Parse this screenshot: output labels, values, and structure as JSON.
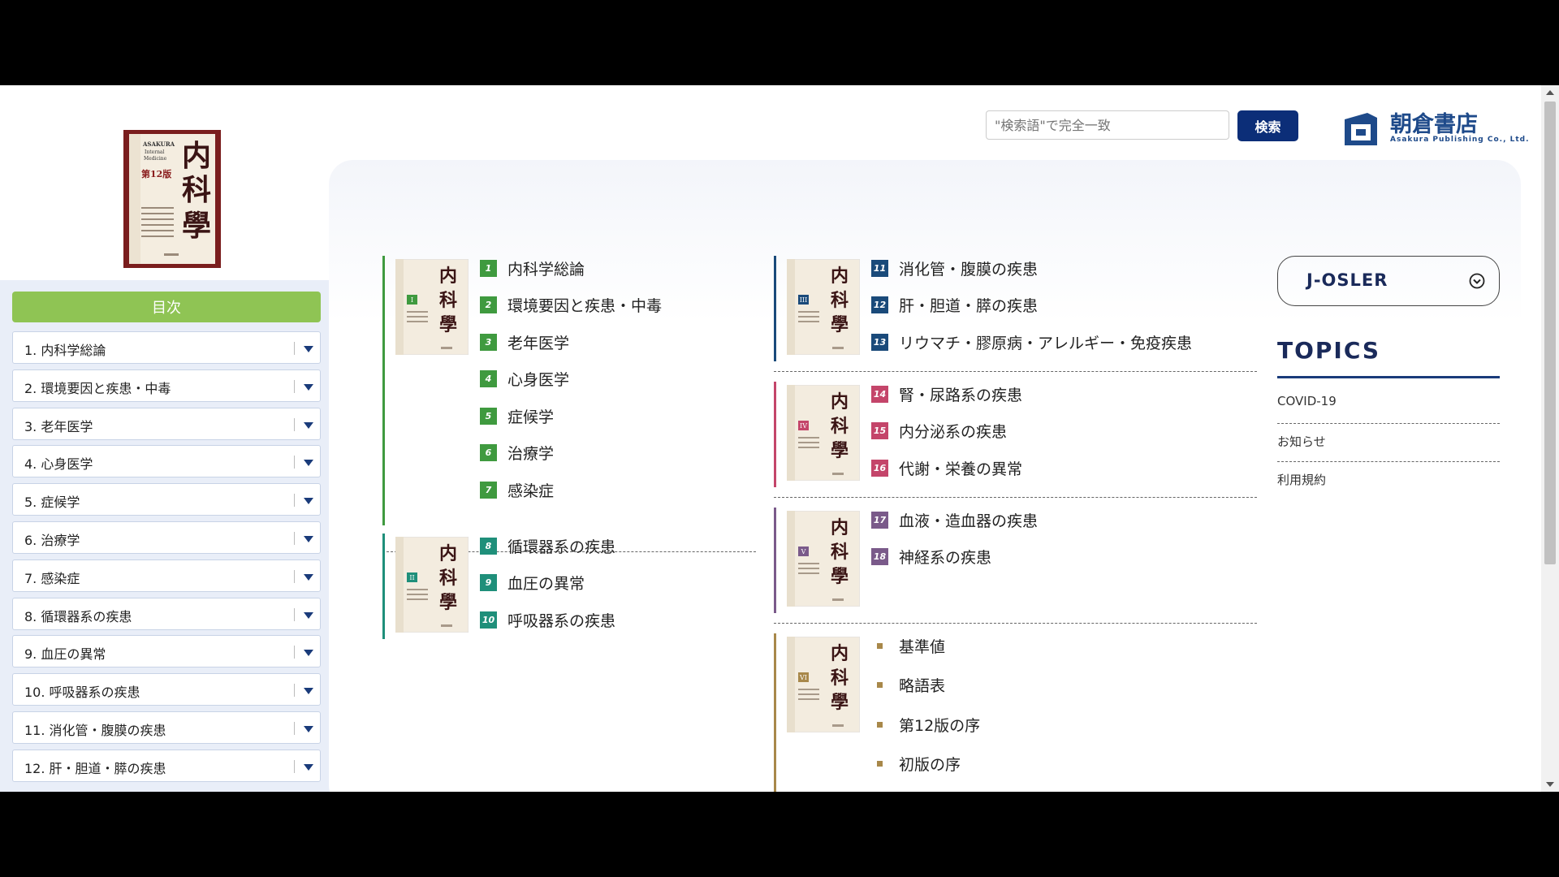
{
  "search": {
    "placeholder": "\"検索語\"で完全一致",
    "button_label": "検索"
  },
  "publisher": {
    "name": "朝倉書店",
    "sub": "Asakura Publishing Co., Ltd."
  },
  "book": {
    "cover_lines": [
      "ASAKURA",
      "Internal",
      "Medicine"
    ],
    "edition": "第12版",
    "title": "内科學"
  },
  "sidebar": {
    "header": "目次",
    "items": [
      "1. 内科学総論",
      "2. 環境要因と疾患・中毒",
      "3. 老年医学",
      "4. 心身医学",
      "5. 症候学",
      "6. 治療学",
      "7. 感染症",
      "8. 循環器系の疾患",
      "9. 血圧の異常",
      "10. 呼吸器系の疾患",
      "11. 消化管・腹膜の疾患",
      "12. 肝・胆道・膵の疾患"
    ]
  },
  "volumes": [
    {
      "roman": "I",
      "color": "#3f9a3f",
      "chapters": [
        {
          "num": "1",
          "title": "内科学総論"
        },
        {
          "num": "2",
          "title": "環境要因と疾患・中毒"
        },
        {
          "num": "3",
          "title": "老年医学"
        },
        {
          "num": "4",
          "title": "心身医学"
        },
        {
          "num": "5",
          "title": "症候学"
        },
        {
          "num": "6",
          "title": "治療学"
        },
        {
          "num": "7",
          "title": "感染症"
        }
      ]
    },
    {
      "roman": "II",
      "color": "#1f8f7a",
      "chapters": [
        {
          "num": "8",
          "title": "循環器系の疾患"
        },
        {
          "num": "9",
          "title": "血圧の異常"
        },
        {
          "num": "10",
          "title": "呼吸器系の疾患"
        }
      ]
    },
    {
      "roman": "III",
      "color": "#1a4a7a",
      "chapters": [
        {
          "num": "11",
          "title": "消化管・腹膜の疾患"
        },
        {
          "num": "12",
          "title": "肝・胆道・膵の疾患"
        },
        {
          "num": "13",
          "title": "リウマチ・膠原病・アレルギー・免疫疾患"
        }
      ]
    },
    {
      "roman": "IV",
      "color": "#c4456a",
      "chapters": [
        {
          "num": "14",
          "title": "腎・尿路系の疾患"
        },
        {
          "num": "15",
          "title": "内分泌系の疾患"
        },
        {
          "num": "16",
          "title": "代謝・栄養の異常"
        }
      ]
    },
    {
      "roman": "V",
      "color": "#7a5a8a",
      "chapters": [
        {
          "num": "17",
          "title": "血液・造血器の疾患"
        },
        {
          "num": "18",
          "title": "神経系の疾患"
        }
      ]
    },
    {
      "roman": "VI",
      "color": "#a8884a",
      "chapters": [
        {
          "title": "基準値"
        },
        {
          "title": "略語表"
        },
        {
          "title": "第12版の序"
        },
        {
          "title": "初版の序"
        }
      ]
    }
  ],
  "right": {
    "josler_label": "J-OSLER",
    "topics_title": "TOPICS",
    "topics": [
      "COVID-19",
      "お知らせ",
      "利用規約"
    ]
  }
}
